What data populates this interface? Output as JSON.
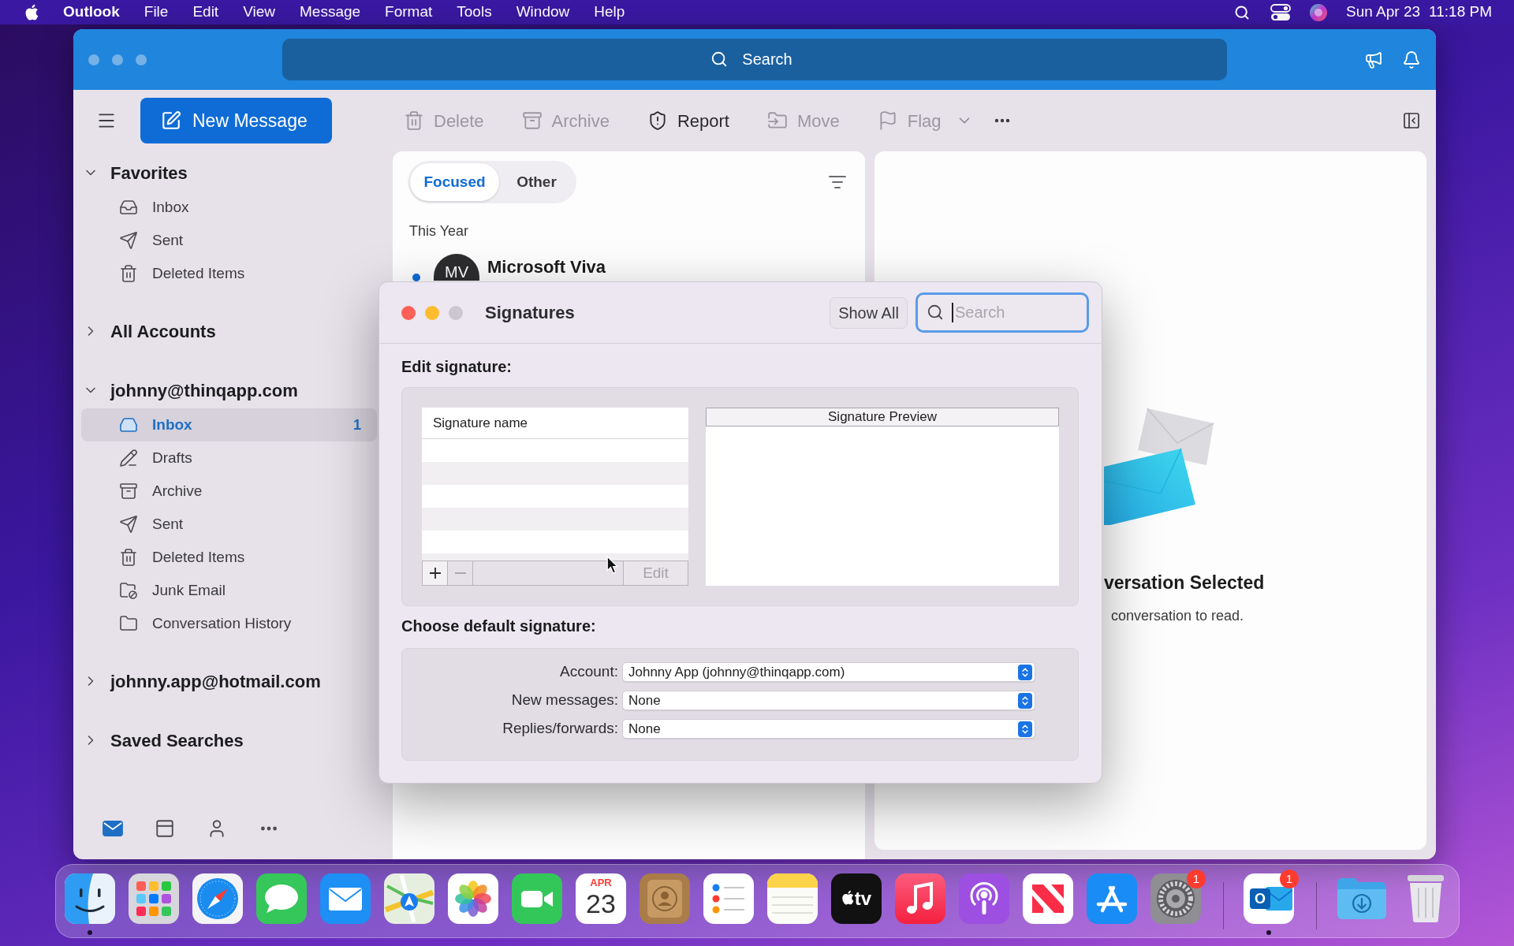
{
  "menu_bar": {
    "app_name": "Outlook",
    "menus": [
      "File",
      "Edit",
      "View",
      "Message",
      "Format",
      "Tools",
      "Window",
      "Help"
    ],
    "date": "Sun Apr 23",
    "time": "11:18 PM"
  },
  "title_bar": {
    "search": {
      "placeholder": "Search"
    }
  },
  "toolbar": {
    "new_message": "New Message",
    "actions": [
      {
        "kind": "delete",
        "label": "Delete",
        "disabled": true
      },
      {
        "kind": "archive",
        "label": "Archive",
        "disabled": true
      },
      {
        "kind": "report",
        "label": "Report",
        "disabled": false
      },
      {
        "kind": "move",
        "label": "Move",
        "disabled": true
      },
      {
        "kind": "flag",
        "label": "Flag",
        "disabled": true
      }
    ]
  },
  "sidebar": {
    "sections": [
      {
        "title": "Favorites",
        "expanded": true,
        "items": [
          {
            "kind": "inbox",
            "label": "Inbox",
            "selected": false
          },
          {
            "kind": "sent",
            "label": "Sent",
            "selected": false
          },
          {
            "kind": "deleted",
            "label": "Deleted Items",
            "selected": false
          }
        ]
      },
      {
        "title": "All Accounts",
        "expanded": false
      },
      {
        "title": "johnny@thinqapp.com",
        "expanded": true,
        "items": [
          {
            "kind": "inbox",
            "label": "Inbox",
            "selected": true,
            "count": "1"
          },
          {
            "kind": "drafts",
            "label": "Drafts",
            "selected": false
          },
          {
            "kind": "archive",
            "label": "Archive",
            "selected": false
          },
          {
            "kind": "sent",
            "label": "Sent",
            "selected": false
          },
          {
            "kind": "deleted",
            "label": "Deleted Items",
            "selected": false
          },
          {
            "kind": "junk",
            "label": "Junk Email",
            "selected": false
          },
          {
            "kind": "history",
            "label": "Conversation History",
            "selected": false
          }
        ]
      },
      {
        "title": "johnny.app@hotmail.com",
        "expanded": false
      },
      {
        "title": "Saved Searches",
        "expanded": false
      }
    ],
    "bottom_nav": [
      {
        "kind": "mail",
        "selected": true
      },
      {
        "kind": "calendar",
        "selected": false
      },
      {
        "kind": "people",
        "selected": false
      },
      {
        "kind": "more",
        "selected": false
      }
    ]
  },
  "message_list": {
    "tabs": [
      {
        "label": "Focused",
        "selected": true
      },
      {
        "label": "Other",
        "selected": false
      }
    ],
    "group": "This Year",
    "messages": [
      {
        "initials": "MV",
        "sender": "Microsoft Viva",
        "unread": true
      }
    ]
  },
  "reading_pane": {
    "title": "versation Selected",
    "hint": "conversation to read."
  },
  "dialog": {
    "title": "Signatures",
    "show_all": "Show All",
    "search": {
      "placeholder": "Search",
      "focused": true
    },
    "edit_heading": "Edit signature:",
    "list_header": "Signature name",
    "list_buttons": [
      {
        "kind": "add",
        "disabled": false
      },
      {
        "kind": "remove",
        "disabled": true
      }
    ],
    "edit": {
      "label": "Edit",
      "disabled": true
    },
    "preview_header": "Signature Preview",
    "default_heading": "Choose default signature:",
    "defaults": [
      {
        "label": "Account:",
        "value": "Johnny App (johnny@thinqapp.com)"
      },
      {
        "label": "New messages:",
        "value": "None"
      },
      {
        "label": "Replies/forwards:",
        "value": "None"
      }
    ]
  },
  "dock": {
    "sections": [
      {
        "apps": [
          {
            "kind": "finder",
            "running": true
          },
          {
            "kind": "launchpad",
            "running": false
          },
          {
            "kind": "safari",
            "running": false
          },
          {
            "kind": "messages",
            "running": false
          },
          {
            "kind": "mail",
            "running": false
          },
          {
            "kind": "maps",
            "running": false
          },
          {
            "kind": "photos",
            "running": false
          },
          {
            "kind": "facetime",
            "running": false
          },
          {
            "kind": "calendar",
            "running": false,
            "month": "APR",
            "day": "23"
          },
          {
            "kind": "contacts",
            "running": false
          },
          {
            "kind": "reminders",
            "running": false
          },
          {
            "kind": "notes",
            "running": false
          },
          {
            "kind": "tv",
            "running": false,
            "label": "tv"
          },
          {
            "kind": "music",
            "running": false
          },
          {
            "kind": "podcasts",
            "running": false
          },
          {
            "kind": "news",
            "running": false
          },
          {
            "kind": "appstore",
            "running": false
          },
          {
            "kind": "settings",
            "running": false,
            "badge": "1"
          }
        ]
      },
      {
        "apps": [
          {
            "kind": "outlook",
            "running": true,
            "badge": "1",
            "letter": "O"
          }
        ]
      },
      {
        "apps": [
          {
            "kind": "downloads",
            "running": false
          },
          {
            "kind": "trash",
            "running": false
          }
        ]
      }
    ]
  }
}
